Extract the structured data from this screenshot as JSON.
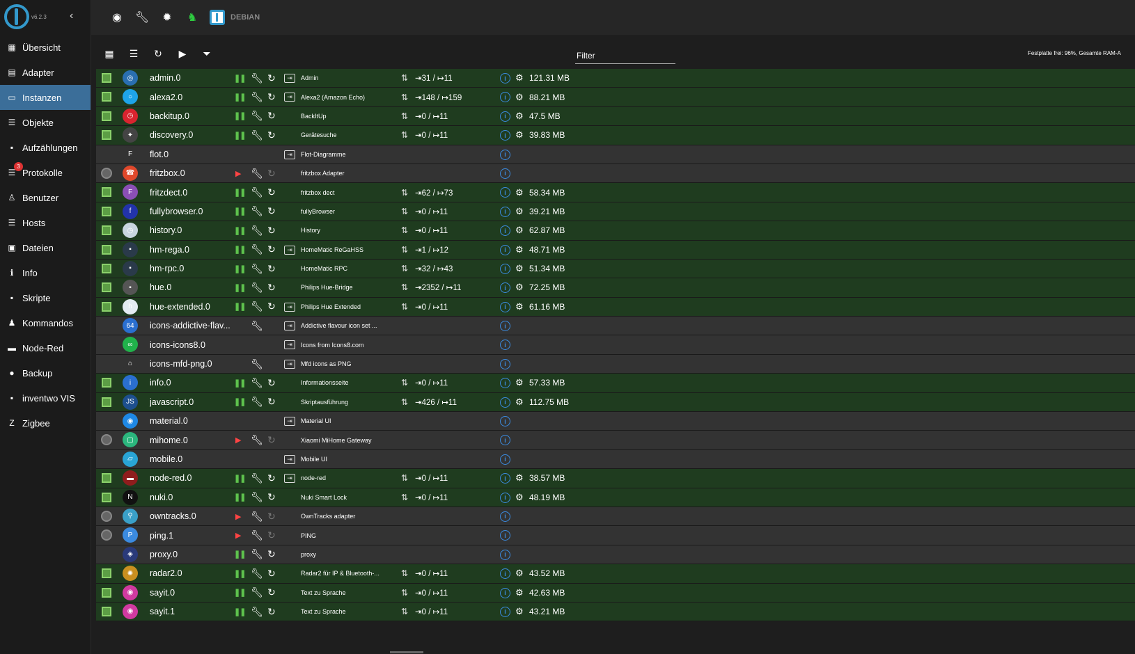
{
  "app": {
    "version": "v6.2.3",
    "host": "DEBIAN"
  },
  "sidebar": {
    "items": [
      {
        "label": "Übersicht",
        "icon": "grid-icon",
        "glyph": "▦"
      },
      {
        "label": "Adapter",
        "icon": "store-icon",
        "glyph": "▤"
      },
      {
        "label": "Instanzen",
        "icon": "instances-icon",
        "glyph": "▭",
        "active": true
      },
      {
        "label": "Objekte",
        "icon": "list-icon",
        "glyph": "☰"
      },
      {
        "label": "Aufzählungen",
        "icon": "enum-icon",
        "glyph": "▪"
      },
      {
        "label": "Protokolle",
        "icon": "log-icon",
        "glyph": "☰",
        "badge": "3"
      },
      {
        "label": "Benutzer",
        "icon": "user-icon",
        "glyph": "♙"
      },
      {
        "label": "Hosts",
        "icon": "hosts-icon",
        "glyph": "☰"
      },
      {
        "label": "Dateien",
        "icon": "files-icon",
        "glyph": "▣"
      },
      {
        "label": "Info",
        "icon": "info-icon",
        "glyph": "ℹ"
      },
      {
        "label": "Skripte",
        "icon": "script-icon",
        "glyph": "▪"
      },
      {
        "label": "Kommandos",
        "icon": "command-icon",
        "glyph": "♟"
      },
      {
        "label": "Node-Red",
        "icon": "node-red-icon",
        "glyph": "▬"
      },
      {
        "label": "Backup",
        "icon": "backup-icon",
        "glyph": "●"
      },
      {
        "label": "inventwo VIS",
        "icon": "vis-icon",
        "glyph": "▪"
      },
      {
        "label": "Zigbee",
        "icon": "zigbee-icon",
        "glyph": "Z"
      }
    ]
  },
  "toolbar": {
    "filter_placeholder": "Filter",
    "disk_info": "Festplatte frei: 96%, Gesamte RAM-A"
  },
  "colors": {
    "active_nav": "#3b6e99",
    "running_row": "#1f3c1f",
    "stopped_row": "#333333",
    "info_blue": "#3b8be0"
  },
  "instances": [
    {
      "name": "admin.0",
      "title": "Admin",
      "running": true,
      "enabled": true,
      "link": true,
      "events": "⇥31 / ↦11",
      "memory": "121.31 MB",
      "icon_color": "#2a6fb0",
      "icon_glyph": "◎"
    },
    {
      "name": "alexa2.0",
      "title": "Alexa2 (Amazon Echo)",
      "running": true,
      "enabled": true,
      "link": true,
      "events": "⇥148 / ↦159",
      "memory": "88.21 MB",
      "icon_color": "#1ea4e9",
      "icon_glyph": "○"
    },
    {
      "name": "backitup.0",
      "title": "BackItUp",
      "running": true,
      "enabled": true,
      "link": false,
      "events": "⇥0 / ↦11",
      "memory": "47.5 MB",
      "icon_color": "#d9242f",
      "icon_glyph": "◷"
    },
    {
      "name": "discovery.0",
      "title": "Gerätesuche",
      "running": true,
      "enabled": true,
      "link": false,
      "events": "⇥0 / ↦11",
      "memory": "39.83 MB",
      "icon_color": "#444",
      "icon_glyph": "✦"
    },
    {
      "name": "flot.0",
      "title": "Flot-Diagramme",
      "running": false,
      "enabled": null,
      "link": true,
      "events": "",
      "memory": "",
      "icon_color": "#333",
      "icon_glyph": "F"
    },
    {
      "name": "fritzbox.0",
      "title": "fritzbox Adapter",
      "running": false,
      "enabled": false,
      "link": false,
      "events": "",
      "memory": "",
      "icon_color": "#e0482b",
      "icon_glyph": "☎"
    },
    {
      "name": "fritzdect.0",
      "title": "fritzbox dect",
      "running": true,
      "enabled": true,
      "link": false,
      "events": "⇥62 / ↦73",
      "memory": "58.34 MB",
      "icon_color": "#8a4fb5",
      "icon_glyph": "F"
    },
    {
      "name": "fullybrowser.0",
      "title": "fullyBrowser",
      "running": true,
      "enabled": true,
      "link": false,
      "events": "⇥0 / ↦11",
      "memory": "39.21 MB",
      "icon_color": "#2233aa",
      "icon_glyph": "f"
    },
    {
      "name": "history.0",
      "title": "History",
      "running": true,
      "enabled": true,
      "link": false,
      "events": "⇥0 / ↦11",
      "memory": "62.87 MB",
      "icon_color": "#c9d6e0",
      "icon_glyph": "◷"
    },
    {
      "name": "hm-rega.0",
      "title": "HomeMatic ReGaHSS",
      "running": true,
      "enabled": true,
      "link": true,
      "events": "⇥1 / ↦12",
      "memory": "48.71 MB",
      "icon_color": "#2a3a4a",
      "icon_glyph": "▪"
    },
    {
      "name": "hm-rpc.0",
      "title": "HomeMatic RPC",
      "running": true,
      "enabled": true,
      "link": false,
      "events": "⇥32 / ↦43",
      "memory": "51.34 MB",
      "icon_color": "#2a3a4a",
      "icon_glyph": "▪"
    },
    {
      "name": "hue.0",
      "title": "Philips Hue-Bridge",
      "running": true,
      "enabled": true,
      "link": false,
      "events": "⇥2352 / ↦11",
      "memory": "72.25 MB",
      "icon_color": "#555",
      "icon_glyph": "▪"
    },
    {
      "name": "hue-extended.0",
      "title": "Philips Hue Extended",
      "running": true,
      "enabled": true,
      "link": true,
      "events": "⇥0 / ↦11",
      "memory": "61.16 MB",
      "icon_color": "#e4ecf2",
      "icon_glyph": "h"
    },
    {
      "name": "icons-addictive-flav...",
      "title": "Addictive flavour icon set ...",
      "running": false,
      "enabled": null,
      "link": true,
      "events": "",
      "memory": "",
      "icon_color": "#2a6fd0",
      "icon_glyph": "64",
      "no_controls": "wrench"
    },
    {
      "name": "icons-icons8.0",
      "title": "Icons from Icons8.com",
      "running": false,
      "enabled": null,
      "link": true,
      "events": "",
      "memory": "",
      "icon_color": "#21b24b",
      "icon_glyph": "∞",
      "no_controls": "all"
    },
    {
      "name": "icons-mfd-png.0",
      "title": "Mfd icons as PNG",
      "running": false,
      "enabled": null,
      "link": true,
      "events": "",
      "memory": "",
      "icon_color": "#333",
      "icon_glyph": "⌂",
      "no_controls": "wrench"
    },
    {
      "name": "info.0",
      "title": "Informationsseite",
      "running": true,
      "enabled": true,
      "link": false,
      "events": "⇥0 / ↦11",
      "memory": "57.33 MB",
      "icon_color": "#2a6fd0",
      "icon_glyph": "i"
    },
    {
      "name": "javascript.0",
      "title": "Skriptausführung",
      "running": true,
      "enabled": true,
      "link": false,
      "events": "⇥426 / ↦11",
      "memory": "112.75 MB",
      "icon_color": "#1d4f8e",
      "icon_glyph": "JS"
    },
    {
      "name": "material.0",
      "title": "Material UI",
      "running": false,
      "enabled": null,
      "link": true,
      "events": "",
      "memory": "",
      "icon_color": "#1e88e5",
      "icon_glyph": "◉",
      "no_controls": "all"
    },
    {
      "name": "mihome.0",
      "title": "Xiaomi MiHome Gateway",
      "running": false,
      "enabled": false,
      "link": false,
      "events": "",
      "memory": "",
      "icon_color": "#2bb67d",
      "icon_glyph": "▢"
    },
    {
      "name": "mobile.0",
      "title": "Mobile UI",
      "running": false,
      "enabled": null,
      "link": true,
      "events": "",
      "memory": "",
      "icon_color": "#29a5d6",
      "icon_glyph": "▱",
      "no_controls": "all"
    },
    {
      "name": "node-red.0",
      "title": "node-red",
      "running": true,
      "enabled": true,
      "link": true,
      "events": "⇥0 / ↦11",
      "memory": "38.57 MB",
      "icon_color": "#8f1d1d",
      "icon_glyph": "▬"
    },
    {
      "name": "nuki.0",
      "title": "Nuki Smart Lock",
      "running": true,
      "enabled": true,
      "link": false,
      "events": "⇥0 / ↦11",
      "memory": "48.19 MB",
      "icon_color": "#111",
      "icon_glyph": "N"
    },
    {
      "name": "owntracks.0",
      "title": "OwnTracks adapter",
      "running": false,
      "enabled": false,
      "link": false,
      "events": "",
      "memory": "",
      "icon_color": "#3aa0c8",
      "icon_glyph": "⚲"
    },
    {
      "name": "ping.1",
      "title": "PING",
      "running": false,
      "enabled": false,
      "link": false,
      "events": "",
      "memory": "",
      "icon_color": "#3b8be0",
      "icon_glyph": "P"
    },
    {
      "name": "proxy.0",
      "title": "proxy",
      "running": false,
      "enabled": null,
      "link": false,
      "events": "",
      "memory": "",
      "icon_color": "#2a3a7a",
      "icon_glyph": "◈",
      "paused_offline": true
    },
    {
      "name": "radar2.0",
      "title": "Radar2 für IP & Bluetooth-...",
      "running": true,
      "enabled": true,
      "link": false,
      "events": "⇥0 / ↦11",
      "memory": "43.52 MB",
      "icon_color": "#c99020",
      "icon_glyph": "✺"
    },
    {
      "name": "sayit.0",
      "title": "Text zu Sprache",
      "running": true,
      "enabled": true,
      "link": false,
      "events": "⇥0 / ↦11",
      "memory": "42.63 MB",
      "icon_color": "#d03aa0",
      "icon_glyph": "◉"
    },
    {
      "name": "sayit.1",
      "title": "Text zu Sprache",
      "running": true,
      "enabled": true,
      "link": false,
      "events": "⇥0 / ↦11",
      "memory": "43.21 MB",
      "icon_color": "#d03aa0",
      "icon_glyph": "◉"
    }
  ]
}
